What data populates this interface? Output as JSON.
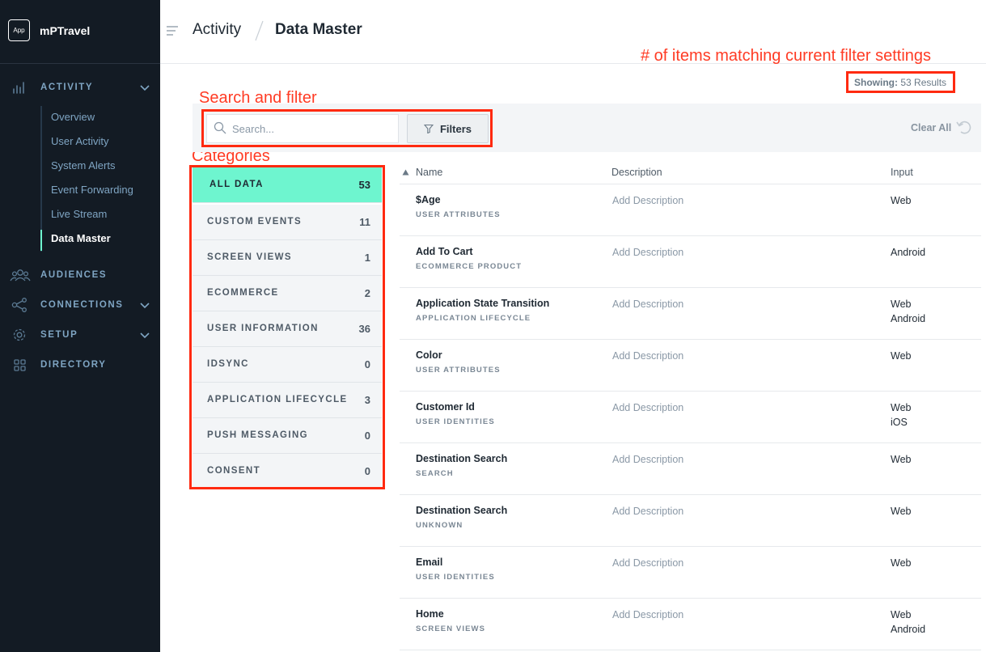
{
  "app": {
    "badge": "App",
    "name": "mPTravel"
  },
  "nav": {
    "activity": "ACTIVITY",
    "sub_items": [
      "Overview",
      "User Activity",
      "System Alerts",
      "Event Forwarding",
      "Live Stream",
      "Data Master"
    ],
    "audiences": "AUDIENCES",
    "connections": "CONNECTIONS",
    "setup": "SETUP",
    "directory": "DIRECTORY"
  },
  "breadcrumb": {
    "parent": "Activity",
    "current": "Data Master"
  },
  "annotations": {
    "items_note": "# of items matching current filter settings",
    "search_note": "Search and filter",
    "categories_note": "Categories"
  },
  "showing": {
    "label": "Showing:",
    "value": "53 Results"
  },
  "search": {
    "placeholder": "Search..."
  },
  "filters": {
    "label": "Filters"
  },
  "clear_all": "Clear All",
  "categories": [
    {
      "label": "ALL DATA",
      "count": "53"
    },
    {
      "label": "CUSTOM EVENTS",
      "count": "11"
    },
    {
      "label": "SCREEN VIEWS",
      "count": "1"
    },
    {
      "label": "ECOMMERCE",
      "count": "2"
    },
    {
      "label": "USER INFORMATION",
      "count": "36"
    },
    {
      "label": "IDSYNC",
      "count": "0"
    },
    {
      "label": "APPLICATION LIFECYCLE",
      "count": "3"
    },
    {
      "label": "PUSH MESSAGING",
      "count": "0"
    },
    {
      "label": "CONSENT",
      "count": "0"
    }
  ],
  "table": {
    "headers": {
      "name": "Name",
      "description": "Description",
      "input": "Input"
    },
    "rows": [
      {
        "name": "$Age",
        "category": "USER ATTRIBUTES",
        "description": "Add Description",
        "input1": "Web",
        "input2": ""
      },
      {
        "name": "Add To Cart",
        "category": "ECOMMERCE PRODUCT",
        "description": "Add Description",
        "input1": "Android",
        "input2": ""
      },
      {
        "name": "Application State Transition",
        "category": "APPLICATION LIFECYCLE",
        "description": "Add Description",
        "input1": "Web",
        "input2": "Android"
      },
      {
        "name": "Color",
        "category": "USER ATTRIBUTES",
        "description": "Add Description",
        "input1": "Web",
        "input2": ""
      },
      {
        "name": "Customer Id",
        "category": "USER IDENTITIES",
        "description": "Add Description",
        "input1": "Web",
        "input2": "iOS"
      },
      {
        "name": "Destination Search",
        "category": "SEARCH",
        "description": "Add Description",
        "input1": "Web",
        "input2": ""
      },
      {
        "name": "Destination Search",
        "category": "UNKNOWN",
        "description": "Add Description",
        "input1": "Web",
        "input2": ""
      },
      {
        "name": "Email",
        "category": "USER IDENTITIES",
        "description": "Add Description",
        "input1": "Web",
        "input2": ""
      },
      {
        "name": "Home",
        "category": "SCREEN VIEWS",
        "description": "Add Description",
        "input1": "Web",
        "input2": "Android"
      }
    ]
  },
  "colors": {
    "sidebar_bg": "#131b24",
    "accent_mint": "#6ef5cf",
    "annotation_red": "#ff3b24",
    "nav_text": "#7fa5c3"
  }
}
